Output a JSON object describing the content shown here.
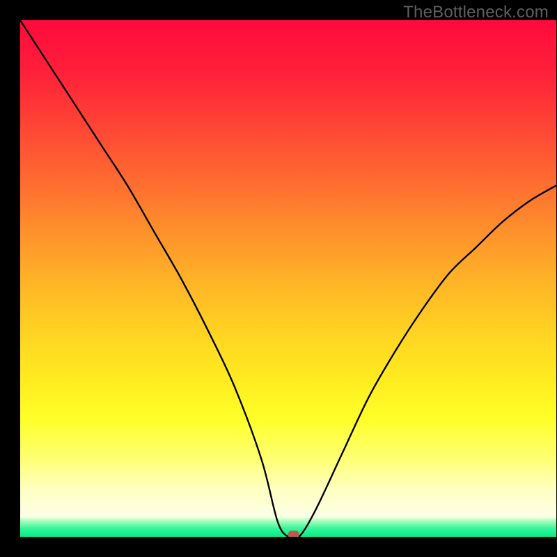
{
  "watermark": "TheBottleneck.com",
  "chart_data": {
    "type": "line",
    "title": "",
    "xlabel": "",
    "ylabel": "",
    "xlim": [
      0,
      100
    ],
    "ylim": [
      0,
      100
    ],
    "grid": false,
    "legend": false,
    "series": [
      {
        "name": "bottleneck-curve",
        "x": [
          0,
          5,
          10,
          15,
          20,
          25,
          30,
          35,
          40,
          45,
          48,
          50,
          52,
          55,
          60,
          65,
          70,
          75,
          80,
          85,
          90,
          95,
          100
        ],
        "y": [
          100,
          92,
          84,
          76,
          68,
          59,
          50,
          40,
          29,
          15,
          3,
          0,
          0,
          5,
          16,
          27,
          36,
          44,
          51,
          56,
          61,
          65,
          68
        ]
      }
    ],
    "annotations": [
      {
        "name": "optimal-marker",
        "x": 51,
        "y": 0.5,
        "shape": "rounded-rect",
        "color": "#b85a4d"
      }
    ],
    "background": {
      "type": "vertical-gradient",
      "stops": [
        {
          "pos": 0.0,
          "color": "#ff0a3c"
        },
        {
          "pos": 0.5,
          "color": "#ffb227"
        },
        {
          "pos": 0.8,
          "color": "#ffff28"
        },
        {
          "pos": 0.97,
          "color": "#fbffe6"
        },
        {
          "pos": 1.0,
          "color": "#00ed88"
        }
      ]
    }
  }
}
